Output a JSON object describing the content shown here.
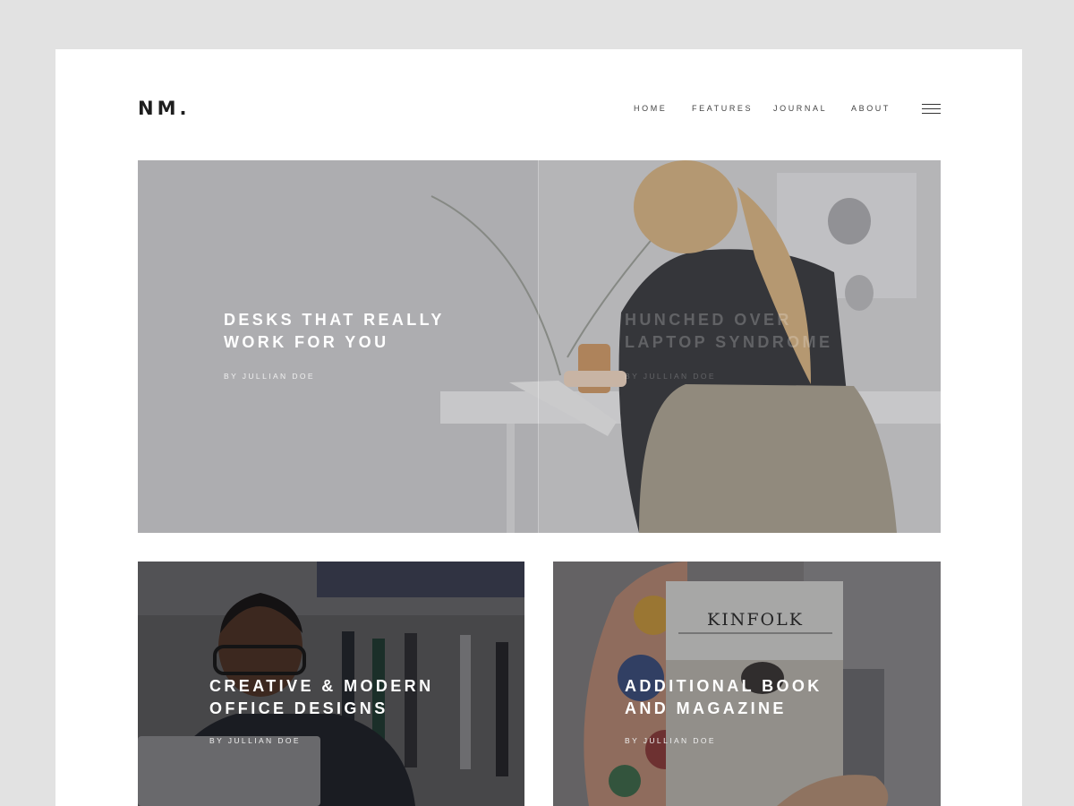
{
  "brand": {
    "logo": "NM."
  },
  "nav": {
    "items": [
      "HOME",
      "FEATURES",
      "JOURNAL",
      "ABOUT"
    ]
  },
  "menu_icon": "hamburger-menu-icon",
  "hero": {
    "slides": [
      {
        "title_line1": "DESKS THAT REALLY",
        "title_line2": "WORK FOR YOU",
        "author": "BY JULLIAN DOE"
      },
      {
        "title_line1": "HUNCHED OVER",
        "title_line2": "LAPTOP SYNDROME",
        "author": "BY JULLIAN DOE"
      }
    ]
  },
  "posts": [
    {
      "title_line1": "CREATIVE & MODERN",
      "title_line2": "OFFICE DESIGNS",
      "author": "BY JULLIAN DOE"
    },
    {
      "title_line1": "ADDITIONAL BOOK",
      "title_line2": "AND MAGAZINE",
      "author": "BY JULLIAN DOE",
      "magazine_cover": "KINFOLK"
    }
  ]
}
